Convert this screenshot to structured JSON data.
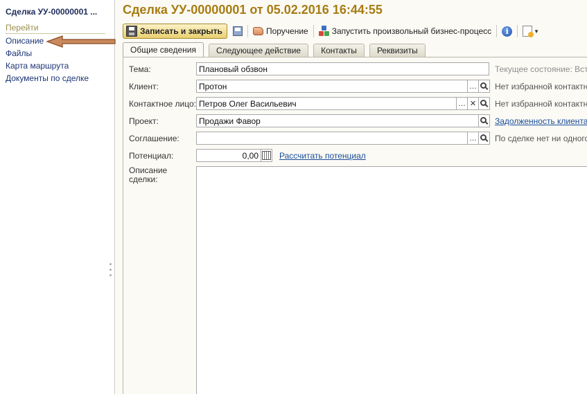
{
  "nav": {
    "title": "Сделка УУ-00000001 ...",
    "header": "Перейти",
    "items": [
      {
        "label": "Описание"
      },
      {
        "label": "Файлы"
      },
      {
        "label": "Карта маршрута"
      },
      {
        "label": "Документы по сделке"
      }
    ]
  },
  "document": {
    "title": "Сделка УУ-00000001 от 05.02.2016 16:44:55"
  },
  "toolbar": {
    "save_close_label": "Записать и закрыть",
    "assignment_label": "Поручение",
    "start_process_label": "Запустить произвольный бизнес-процесс"
  },
  "tabs": [
    {
      "label": "Общие сведения",
      "active": true
    },
    {
      "label": "Следующее действие",
      "active": false
    },
    {
      "label": "Контакты",
      "active": false
    },
    {
      "label": "Реквизиты",
      "active": false
    }
  ],
  "form": {
    "topic": {
      "label": "Тема:",
      "value": "Плановый обзвон",
      "side": "Текущее состояние: Встре"
    },
    "client": {
      "label": "Клиент:",
      "value": "Протон",
      "side": "Нет избранной контактной"
    },
    "contact": {
      "label": "Контактное лицо:",
      "value": "Петров Олег Васильевич",
      "side": "Нет избранной контактной"
    },
    "project": {
      "label": "Проект:",
      "value": "Продажи Фавор",
      "side_link": "Задолженность клиента"
    },
    "agreement": {
      "label": "Соглашение:",
      "value": "",
      "side": "По сделке нет ни одного с"
    },
    "potential": {
      "label": "Потенциал:",
      "value": "0,00",
      "link": "Рассчитать потенциал"
    },
    "description": {
      "label": "Описание сделки:",
      "value": ""
    }
  },
  "colors": {
    "title": "#a77c12",
    "link": "#1a4d99",
    "nav_link": "#1c3575",
    "arrow": "#b86a3c"
  }
}
